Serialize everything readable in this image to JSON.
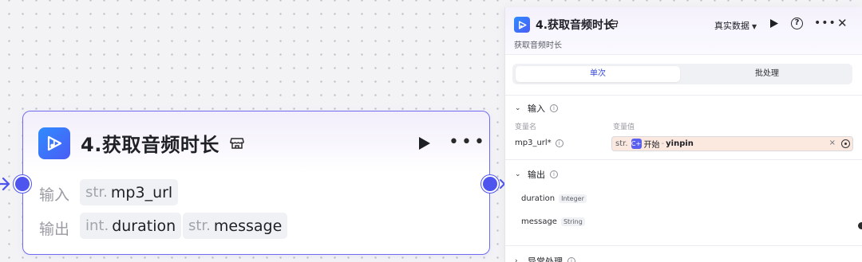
{
  "node": {
    "title": "4.获取音频时长",
    "input_label": "输入",
    "output_label": "输出",
    "inputs": [
      {
        "type": "str.",
        "name": "mp3_url"
      }
    ],
    "outputs": [
      {
        "type": "int.",
        "name": "duration"
      },
      {
        "type": "str.",
        "name": "message"
      }
    ]
  },
  "panel": {
    "title": "4.获取音频时长",
    "subtitle": "获取音频时长",
    "data_mode": "真实数据",
    "tabs": [
      "单次",
      "批处理"
    ],
    "input_section": {
      "title": "输入",
      "col_name": "变量名",
      "col_value": "变量值",
      "param_name": "mp3_url*",
      "ref_type": "str.",
      "ref_icon": "C+",
      "ref_node": "开始",
      "ref_sep": "-",
      "ref_var": "yinpin",
      "clear": "×"
    },
    "output_section": {
      "title": "输出",
      "items": [
        {
          "name": "duration",
          "type": "Integer"
        },
        {
          "name": "message",
          "type": "String"
        }
      ]
    },
    "exception_section": {
      "title": "异常处理"
    }
  },
  "colors": {
    "accent": "#4e54ee",
    "node_border": "#6f6bf0",
    "ref_bg": "#fbe9e0"
  }
}
